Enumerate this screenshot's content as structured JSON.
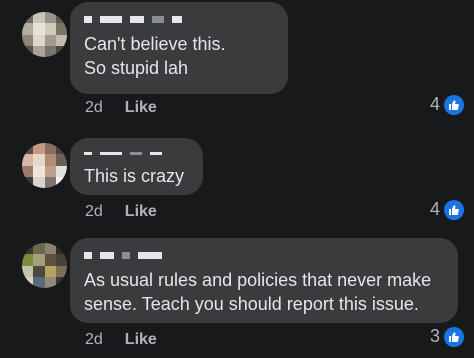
{
  "comments": [
    {
      "text": "Can't believe this.\nSo stupid lah",
      "time": "2d",
      "like_label": "Like",
      "reaction_count": "4"
    },
    {
      "text": "This is crazy",
      "time": "2d",
      "like_label": "Like",
      "reaction_count": "4"
    },
    {
      "text": "As usual rules and policies that never make\nsense. Teach you should report this issue.",
      "time": "2d",
      "like_label": "Like",
      "reaction_count": "3"
    }
  ],
  "colors": {
    "background": "#18191a",
    "bubble": "#3a3b3c",
    "text": "#e4e6eb",
    "secondary_text": "#b0b3b8",
    "like_blue": "#1b74e4"
  },
  "icons": {
    "reaction": "thumbs-up-icon"
  }
}
